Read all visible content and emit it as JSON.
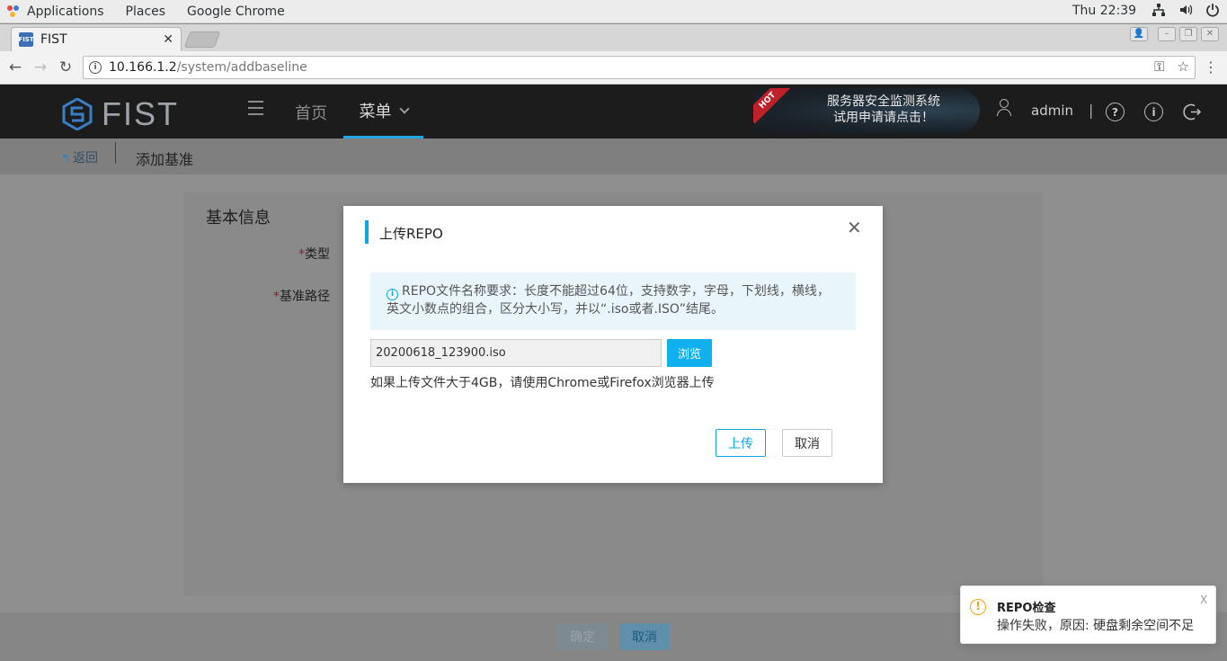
{
  "gnome": {
    "applications": "Applications",
    "places": "Places",
    "browser_app": "Google Chrome",
    "clock": "Thu 22:39"
  },
  "browser": {
    "tab_title": "FIST",
    "favicon_text": "FIST",
    "url_host": "10.166.1.2",
    "url_path": "/system/addbaseline"
  },
  "header": {
    "logo_text": "FIST",
    "nav_home": "首页",
    "nav_menu": "菜单",
    "promo_badge": "HOT",
    "promo_line1": "服务器安全监测系统",
    "promo_line2": "试用申请请点击！",
    "username": "admin",
    "help_icon": "?",
    "info_icon": "i"
  },
  "subheader": {
    "back_label": "返回",
    "page_title": "添加基准"
  },
  "form": {
    "section_title": "基本信息",
    "type_label": "类型",
    "path_label": "基准路径",
    "required_mark": "*",
    "confirm_button": "确定",
    "cancel_button": "取消"
  },
  "modal": {
    "title": "上传REPO",
    "notice": "REPO文件名称要求：长度不能超过64位，支持数字，字母，下划线，横线，英文小数点的组合，区分大小写，并以“.iso或者.ISO”结尾。",
    "file_value": "20200618_123900.iso",
    "browse_button": "浏览",
    "hint": "如果上传文件大于4GB，请使用Chrome或Firefox浏览器上传",
    "upload_button": "上传",
    "cancel_button": "取消"
  },
  "toast": {
    "title": "REPO检查",
    "message": "操作失败，原因: 硬盘剩余空间不足",
    "close": "X"
  },
  "colors": {
    "accent": "#10a6e3",
    "header_bg": "#1c1c1c",
    "warning": "#f3a30f",
    "hot_badge": "#c0202a"
  }
}
